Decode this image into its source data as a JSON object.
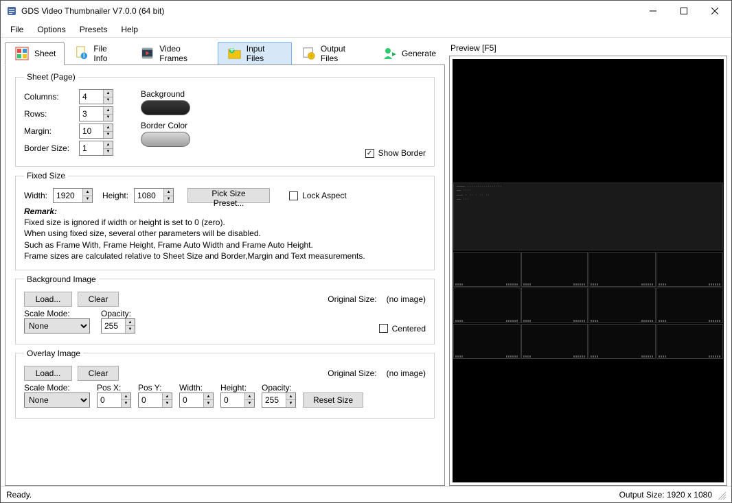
{
  "window": {
    "title": "GDS Video Thumbnailer V7.0.0 (64 bit)"
  },
  "menu": {
    "file": "File",
    "options": "Options",
    "presets": "Presets",
    "help": "Help"
  },
  "tabs": {
    "sheet": "Sheet",
    "fileinfo": "File Info",
    "videoframes": "Video Frames",
    "inputfiles": "Input Files",
    "outputfiles": "Output Files",
    "generate": "Generate"
  },
  "sheet": {
    "legend": "Sheet (Page)",
    "columns_lbl": "Columns:",
    "columns": "4",
    "rows_lbl": "Rows:",
    "rows": "3",
    "margin_lbl": "Margin:",
    "margin": "10",
    "bordersize_lbl": "Border Size:",
    "bordersize": "1",
    "background_lbl": "Background",
    "bordercolor_lbl": "Border Color",
    "showborder_lbl": "Show Border",
    "bg_color": "#2b2b2b",
    "border_color": "#b3b3b3"
  },
  "fixed": {
    "legend": "Fixed Size",
    "width_lbl": "Width:",
    "width": "1920",
    "height_lbl": "Height:",
    "height": "1080",
    "pickpreset": "Pick Size Preset...",
    "lockaspect_lbl": "Lock Aspect",
    "remark_head": "Remark:",
    "remark1": "Fixed size is ignored if width or height is set to 0 (zero).",
    "remark2": "When using fixed size, several other parameters will be disabled.",
    "remark3": "Such as Frame With, Frame Height, Frame Auto Width and Frame Auto Height.",
    "remark4": "Frame sizes are calculated relative to Sheet Size and Border,Margin and Text measurements."
  },
  "bgimg": {
    "legend": "Background Image",
    "load": "Load...",
    "clear": "Clear",
    "origsize_lbl": "Original Size:",
    "origsize_val": "(no image)",
    "scalemode_lbl": "Scale Mode:",
    "scalemode": "None",
    "opacity_lbl": "Opacity:",
    "opacity": "255",
    "centered_lbl": "Centered"
  },
  "ovimg": {
    "legend": "Overlay Image",
    "load": "Load...",
    "clear": "Clear",
    "origsize_lbl": "Original Size:",
    "origsize_val": "(no image)",
    "scalemode_lbl": "Scale Mode:",
    "scalemode": "None",
    "posx_lbl": "Pos X:",
    "posx": "0",
    "posy_lbl": "Pos Y:",
    "posy": "0",
    "width_lbl": "Width:",
    "width": "0",
    "height_lbl": "Height:",
    "height": "0",
    "opacity_lbl": "Opacity:",
    "opacity": "255",
    "resetsize": "Reset Size"
  },
  "preview": {
    "label": "Preview  [F5]"
  },
  "status": {
    "ready": "Ready.",
    "outsize": "Output Size: 1920 x 1080"
  }
}
